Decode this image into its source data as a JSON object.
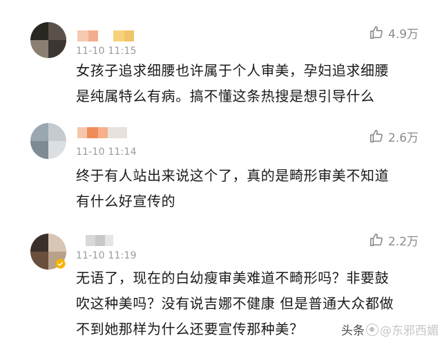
{
  "comments": [
    {
      "time": "11-10 11:15",
      "likes": "4.9万",
      "lines": [
        "女孩子追求细腰也许属于个人审美，孕妇追求细腰",
        "是纯属特么有病。搞不懂这条热搜是想引导什么"
      ],
      "avatar_colors": [
        "#2a2622",
        "#5a524a",
        "#8a7f72",
        "#3b3631",
        "#c9c2b8",
        "#1b1815"
      ],
      "name_colors": [
        "#f6c9b0",
        "#f2ad8c",
        "#f7d27a",
        "#f0c46a"
      ]
    },
    {
      "time": "11-10 11:14",
      "likes": "2.6万",
      "lines": [
        "终于有人站出来说这个了，真的是畸形审美不知道",
        "有什么好宣传的"
      ],
      "avatar_colors": [
        "#9aa6b0",
        "#c6cbd0",
        "#7e8a94",
        "#dcdfe2",
        "#b0b8be",
        "#8c949a"
      ],
      "name_colors": [
        "#f5c8aa",
        "#f08c5a",
        "#f7b08a",
        "#e8e2de"
      ]
    },
    {
      "time": "11-10 11:19",
      "likes": "2.2万",
      "lines": [
        "无语了，现在的白幼瘦审美难道不畸形吗？非要鼓",
        "吹这种美吗？没有说吉娜不健康 但是普通大众都做",
        "不到她那样为什么还要宣传那种美？"
      ],
      "avatar_colors": [
        "#3a2f2a",
        "#d8c6b4",
        "#6a4e3e",
        "#b9a08a",
        "#2b2320",
        "#e2d4c4"
      ],
      "name_colors": [
        "#d8d8d8",
        "#c8c8c8",
        "#e6e6e6",
        "#d0d0d0"
      ]
    }
  ],
  "watermark": {
    "prefix": "头条",
    "brand": "@东邪西媚"
  },
  "icons": {
    "like": "thumbs-up-icon",
    "verified": "verified-badge-icon",
    "watermark": "toutiao-logo-icon"
  }
}
